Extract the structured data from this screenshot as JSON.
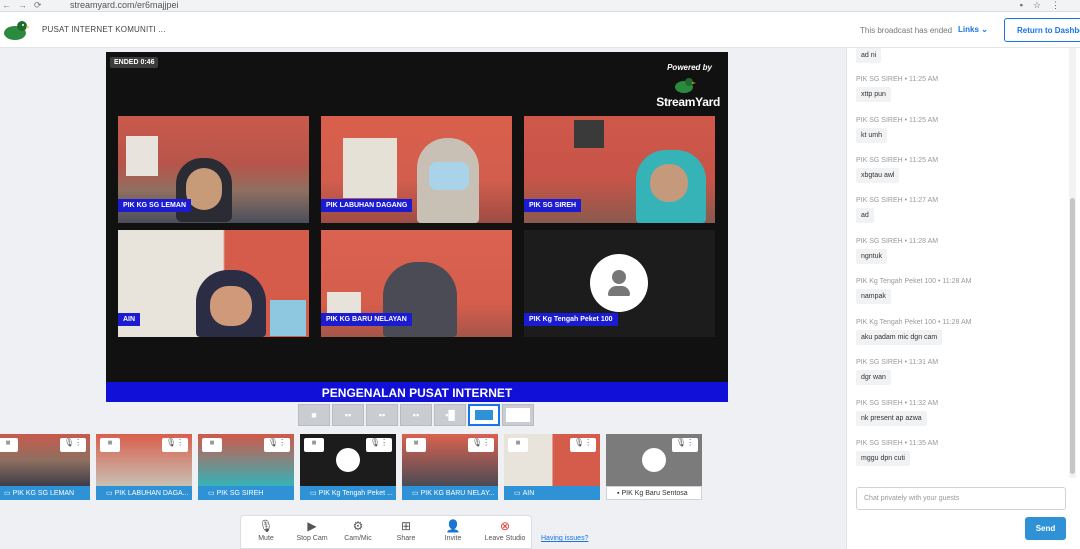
{
  "browser": {
    "url": "streamyard.com/er6majjpei"
  },
  "header": {
    "studio_name": "PUSAT INTERNET KOMUNITI ...",
    "ended_text": "This broadcast has ended",
    "links_label": "Links",
    "return_label": "Return to Dashboard"
  },
  "stage": {
    "ended_badge": "ENDED 0:46",
    "powered_by": "Powered by",
    "brand": "StreamYard",
    "banner": "PENGENALAN PUSAT INTERNET",
    "tiles": [
      {
        "name": "PIK KG SG LEMAN"
      },
      {
        "name": "PIK LABUHAN DAGANG"
      },
      {
        "name": "PIK SG SIREH"
      },
      {
        "name": "AIN"
      },
      {
        "name": "PIK KG BARU NELAYAN"
      },
      {
        "name": "PIK Kg Tengah Peket 100"
      }
    ]
  },
  "strip": [
    {
      "name": "PIK KG SG LEMAN"
    },
    {
      "name": "PIK LABUHAN DAGA..."
    },
    {
      "name": "PIK SG SIREH"
    },
    {
      "name": "PIK Kg Tengah Peket ..."
    },
    {
      "name": "PIK KG BARU NELAY..."
    },
    {
      "name": "AIN"
    },
    {
      "name": "PIK Kg Baru Sentosa"
    }
  ],
  "controls": {
    "mute": "Mute",
    "stop_cam": "Stop Cam",
    "cam_mic": "Cam/Mic",
    "share": "Share",
    "invite": "Invite",
    "leave": "Leave Studio",
    "issues": "Having issues?"
  },
  "chat": {
    "messages": [
      {
        "meta": "",
        "text": "ad ni"
      },
      {
        "meta": "PIK SG SIREH • 11:25 AM",
        "text": "xttp pun"
      },
      {
        "meta": "PIK SG SIREH • 11:25 AM",
        "text": "kt umh"
      },
      {
        "meta": "PIK SG SIREH • 11:25 AM",
        "text": "xbgtau awl"
      },
      {
        "meta": "PIK SG SIREH • 11:27 AM",
        "text": "ad"
      },
      {
        "meta": "PIK SG SIREH • 11:28 AM",
        "text": "ngntuk"
      },
      {
        "meta": "PIK Kg Tengah Peket 100 • 11:28 AM",
        "text": "nampak"
      },
      {
        "meta": "PIK Kg Tengah Peket 100 • 11:28 AM",
        "text": "aku padam mic dgn cam"
      },
      {
        "meta": "PIK SG SIREH • 11:31 AM",
        "text": "dgr wan"
      },
      {
        "meta": "PIK SG SIREH • 11:32 AM",
        "text": "nk present ap azwa"
      },
      {
        "meta": "PIK SG SIREH • 11:35 AM",
        "text": "mggu dpn cuti"
      }
    ],
    "placeholder": "Chat privately with your guests",
    "send_label": "Send"
  },
  "colors": {
    "name_tag": "#1b1bd1",
    "banner": "#1010d8",
    "accent": "#1a73e8",
    "strip_label": "#2f92d7",
    "leave_red": "#e53935"
  }
}
